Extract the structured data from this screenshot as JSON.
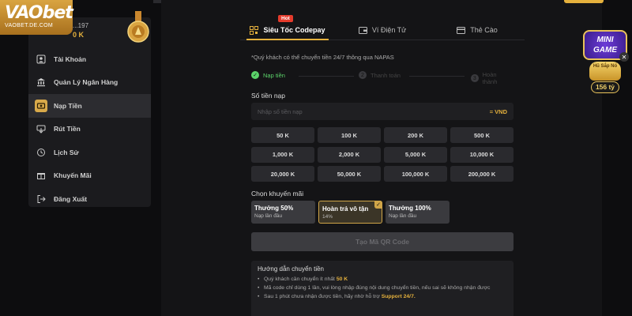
{
  "logo": {
    "text": "VAObet",
    "sub": "VAOBET.DE.COM"
  },
  "profile": {
    "username": "...197",
    "balance": "0 K"
  },
  "sidebar": {
    "items": [
      {
        "label": "Tài Khoản",
        "icon": "user-icon"
      },
      {
        "label": "Quản Lý Ngân Hàng",
        "icon": "bank-icon"
      },
      {
        "label": "Nạp Tiền",
        "icon": "deposit-icon",
        "active": true
      },
      {
        "label": "Rút Tiền",
        "icon": "withdraw-icon"
      },
      {
        "label": "Lịch Sử",
        "icon": "history-icon"
      },
      {
        "label": "Khuyến Mãi",
        "icon": "gift-icon"
      },
      {
        "label": "Đăng Xuất",
        "icon": "logout-icon"
      }
    ]
  },
  "tabs": [
    {
      "label": "Siêu Tốc Codepay",
      "badge": "Hot",
      "icon": "qr-icon"
    },
    {
      "label": "Ví Điện Tử",
      "icon": "wallet-icon"
    },
    {
      "label": "Thẻ Cào",
      "icon": "card-icon"
    }
  ],
  "note": "*Quý khách có thể chuyển tiền 24/7 thông qua NAPAS",
  "steps": [
    {
      "label": "Nạp tiền",
      "num": "✓"
    },
    {
      "label": "Thanh toán",
      "num": "2"
    },
    {
      "label": "Hoàn thành",
      "num": "3"
    }
  ],
  "amount": {
    "label": "Số tiền nạp",
    "placeholder": "Nhập số tiền nạp",
    "unit": "= VND",
    "options": [
      "50 K",
      "100 K",
      "200 K",
      "500 K",
      "1,000 K",
      "2,000 K",
      "5,000 K",
      "10,000 K",
      "20,000 K",
      "50,000 K",
      "100,000 K",
      "200,000 K"
    ]
  },
  "promo": {
    "label": "Chọn khuyến mãi",
    "options": [
      {
        "title": "Thưởng 50%",
        "sub": "Nạp lần đầu"
      },
      {
        "title": "Hoàn trả vô tận",
        "sub": "14%",
        "selected": true
      },
      {
        "title": "Thưởng 100%",
        "sub": "Nạp lần đầu"
      }
    ]
  },
  "submit_label": "Tạo Mã QR Code",
  "guide": {
    "title": "Hướng dẫn chuyển tiền",
    "lines": [
      {
        "text": "Quý khách cần chuyển ít nhất ",
        "highlight": "50 K"
      },
      {
        "text": "Mã code chỉ dùng 1 lần, vui lòng nhập đúng nội dung chuyển tiền, nếu sai sẽ không nhận được",
        "highlight": ""
      },
      {
        "text": "Sau 1 phút chưa nhận được tiền, hãy nhờ hỗ trợ ",
        "highlight": "Support 24/7."
      }
    ]
  },
  "minigame": {
    "title_line1": "MINI",
    "title_line2": "GAME",
    "jar_label": "Hũ Sắp Nổ",
    "value": "156 tỷ"
  },
  "colors": {
    "accent": "#e5b13d",
    "success": "#5bd36a",
    "hot": "#e53b2c"
  }
}
